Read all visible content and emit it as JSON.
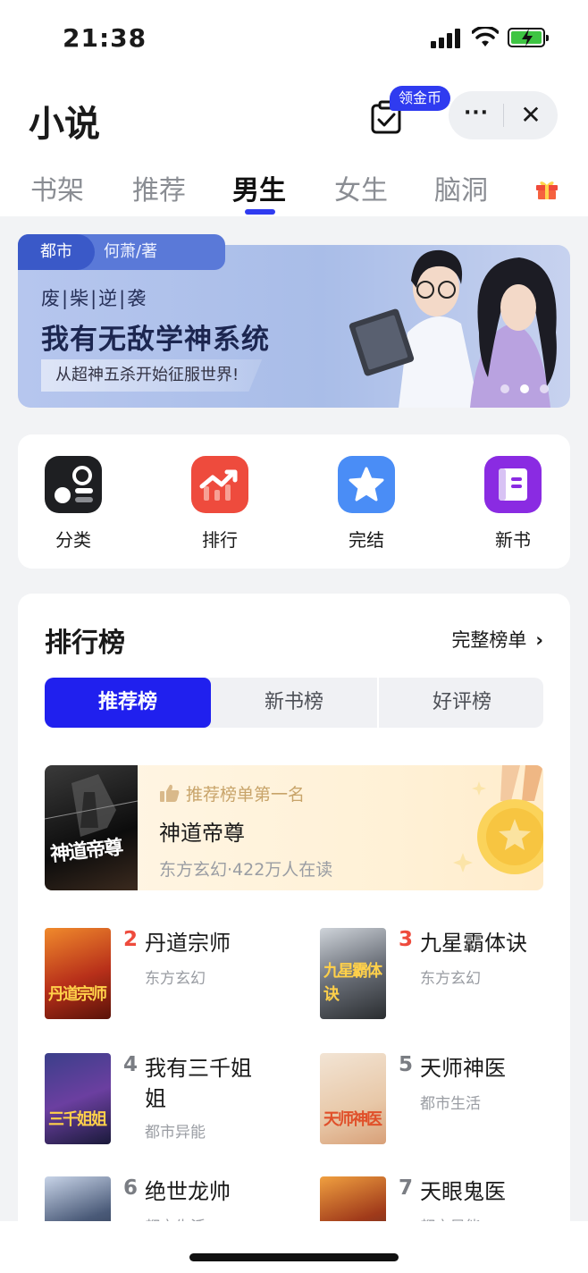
{
  "status_bar": {
    "time": "21:38"
  },
  "header": {
    "title": "小说",
    "coin_badge": "领金币",
    "more": "···",
    "close": "✕"
  },
  "tabs": [
    {
      "label": "书架",
      "active": false
    },
    {
      "label": "推荐",
      "active": false
    },
    {
      "label": "男生",
      "active": true
    },
    {
      "label": "女生",
      "active": false
    },
    {
      "label": "脑洞",
      "active": false
    }
  ],
  "banner": {
    "genre": "都市",
    "author": "何萧/著",
    "kicker": "废|柴|逆|袭",
    "title": "我有无敌学神系统",
    "slogan": "从超神五杀开始征服世界!",
    "page_count": 3,
    "active_page": 2
  },
  "quick_entries": [
    {
      "label": "分类",
      "icon": "category-icon",
      "color": "#1e1f22"
    },
    {
      "label": "排行",
      "icon": "trend-chart-icon",
      "color": "#ee4b3d"
    },
    {
      "label": "完结",
      "icon": "star-icon",
      "color": "#4a8df6"
    },
    {
      "label": "新书",
      "icon": "book-icon",
      "color": "#8a2be2"
    }
  ],
  "ranking": {
    "title": "排行榜",
    "full_list": "完整榜单",
    "segments": [
      {
        "label": "推荐榜",
        "active": true
      },
      {
        "label": "新书榜",
        "active": false
      },
      {
        "label": "好评榜",
        "active": false
      }
    ],
    "top1": {
      "kicker": "推荐榜单第一名",
      "title": "神道帝尊",
      "meta": "东方玄幻·422万人在读",
      "cover_text": "神道帝尊"
    },
    "books": [
      {
        "rank": "2",
        "title": "丹道宗师",
        "genre": "东方玄幻",
        "cover_text": "丹道宗师"
      },
      {
        "rank": "3",
        "title": "九星霸体诀",
        "genre": "东方玄幻",
        "cover_text": "九星霸体诀"
      },
      {
        "rank": "4",
        "title": "我有三千姐姐",
        "genre": "都市异能",
        "cover_text": "三千姐姐"
      },
      {
        "rank": "5",
        "title": "天师神医",
        "genre": "都市生活",
        "cover_text": "天师神医"
      },
      {
        "rank": "6",
        "title": "绝世龙帅",
        "genre": "都市生活",
        "cover_text": ""
      },
      {
        "rank": "7",
        "title": "天眼鬼医",
        "genre": "都市异能",
        "cover_text": ""
      }
    ]
  },
  "colors": {
    "accent": "#2020ee",
    "rank_red": "#ee4b3d"
  }
}
